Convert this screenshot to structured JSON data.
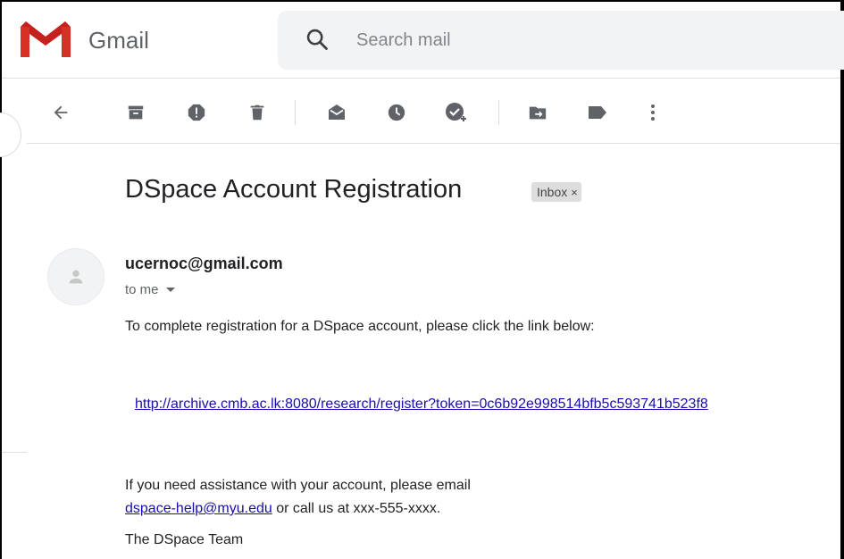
{
  "app": {
    "name": "Gmail"
  },
  "colors": {
    "logo_red": "#EA4335",
    "link": "#1a0dab",
    "icon_gray": "#5f6368"
  },
  "search": {
    "placeholder": "Search mail",
    "icon": "search-icon"
  },
  "toolbar": {
    "buttons": [
      {
        "name": "back",
        "icon": "arrow-back-icon"
      },
      {
        "name": "archive",
        "icon": "archive-icon"
      },
      {
        "name": "report-spam",
        "icon": "report-spam-icon"
      },
      {
        "name": "delete",
        "icon": "trash-icon"
      },
      {
        "name": "mark-unread",
        "icon": "mark-unread-icon"
      },
      {
        "name": "snooze",
        "icon": "clock-icon"
      },
      {
        "name": "add-to-tasks",
        "icon": "add-task-icon"
      },
      {
        "name": "move-to",
        "icon": "move-to-folder-icon"
      },
      {
        "name": "labels",
        "icon": "label-icon"
      },
      {
        "name": "more",
        "icon": "more-vert-icon"
      }
    ]
  },
  "email": {
    "subject": "DSpace Account Registration",
    "label": "Inbox",
    "label_remove": "×",
    "sender": "ucernoc@gmail.com",
    "recipient": "to me",
    "body": {
      "intro": "To complete registration for a DSpace account, please click the link below:",
      "link": "http://archive.cmb.ac.lk:8080/research/register?token=0c6b92e998514bfb5c593741b523f8",
      "help_prefix": "If you need assistance with your account, please email",
      "help_email": "dspace-help@myu.edu",
      "help_suffix": " or call us at xxx-555-xxxx.",
      "signature": "The DSpace Team"
    }
  }
}
